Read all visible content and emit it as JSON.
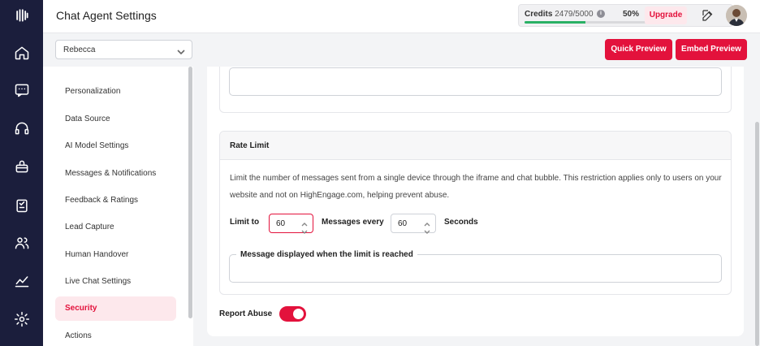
{
  "header": {
    "title": "Chat Agent Settings",
    "credits_label": "Credits",
    "credits_value": "2479/5000",
    "credits_percent": "50%",
    "credits_progress": 0.5,
    "upgrade_label": "Upgrade",
    "accent_color": "#e3123c"
  },
  "toolbar": {
    "agent_selected": "Rebecca",
    "quick_preview_label": "Quick Preview",
    "embed_preview_label": "Embed Preview"
  },
  "rail": {
    "icons": [
      "logo-icon",
      "home-icon",
      "chat-icon",
      "headset-icon",
      "briefcase-icon",
      "clipboard-icon",
      "users-icon",
      "chart-icon",
      "settings-icon"
    ]
  },
  "sidebar": {
    "items": [
      {
        "label": "Personalization"
      },
      {
        "label": "Data Source"
      },
      {
        "label": "AI Model Settings"
      },
      {
        "label": "Messages & Notifications"
      },
      {
        "label": "Feedback & Ratings"
      },
      {
        "label": "Lead Capture"
      },
      {
        "label": "Human Handover"
      },
      {
        "label": "Live Chat Settings"
      },
      {
        "label": "Security",
        "active": true
      },
      {
        "label": "Actions"
      }
    ]
  },
  "rate_limit": {
    "title": "Rate Limit",
    "description": "Limit the number of messages sent from a single device through the iframe and chat bubble. This restriction applies only to users on your website and not on HighEngage.com, helping prevent abuse.",
    "limit_label": "Limit to",
    "limit_value": "60",
    "messages_every_label": "Messages every",
    "interval_value": "60",
    "seconds_label": "Seconds",
    "message_field_label": "Message displayed when the limit is reached"
  },
  "report_abuse": {
    "label": "Report Abuse",
    "enabled": true
  }
}
